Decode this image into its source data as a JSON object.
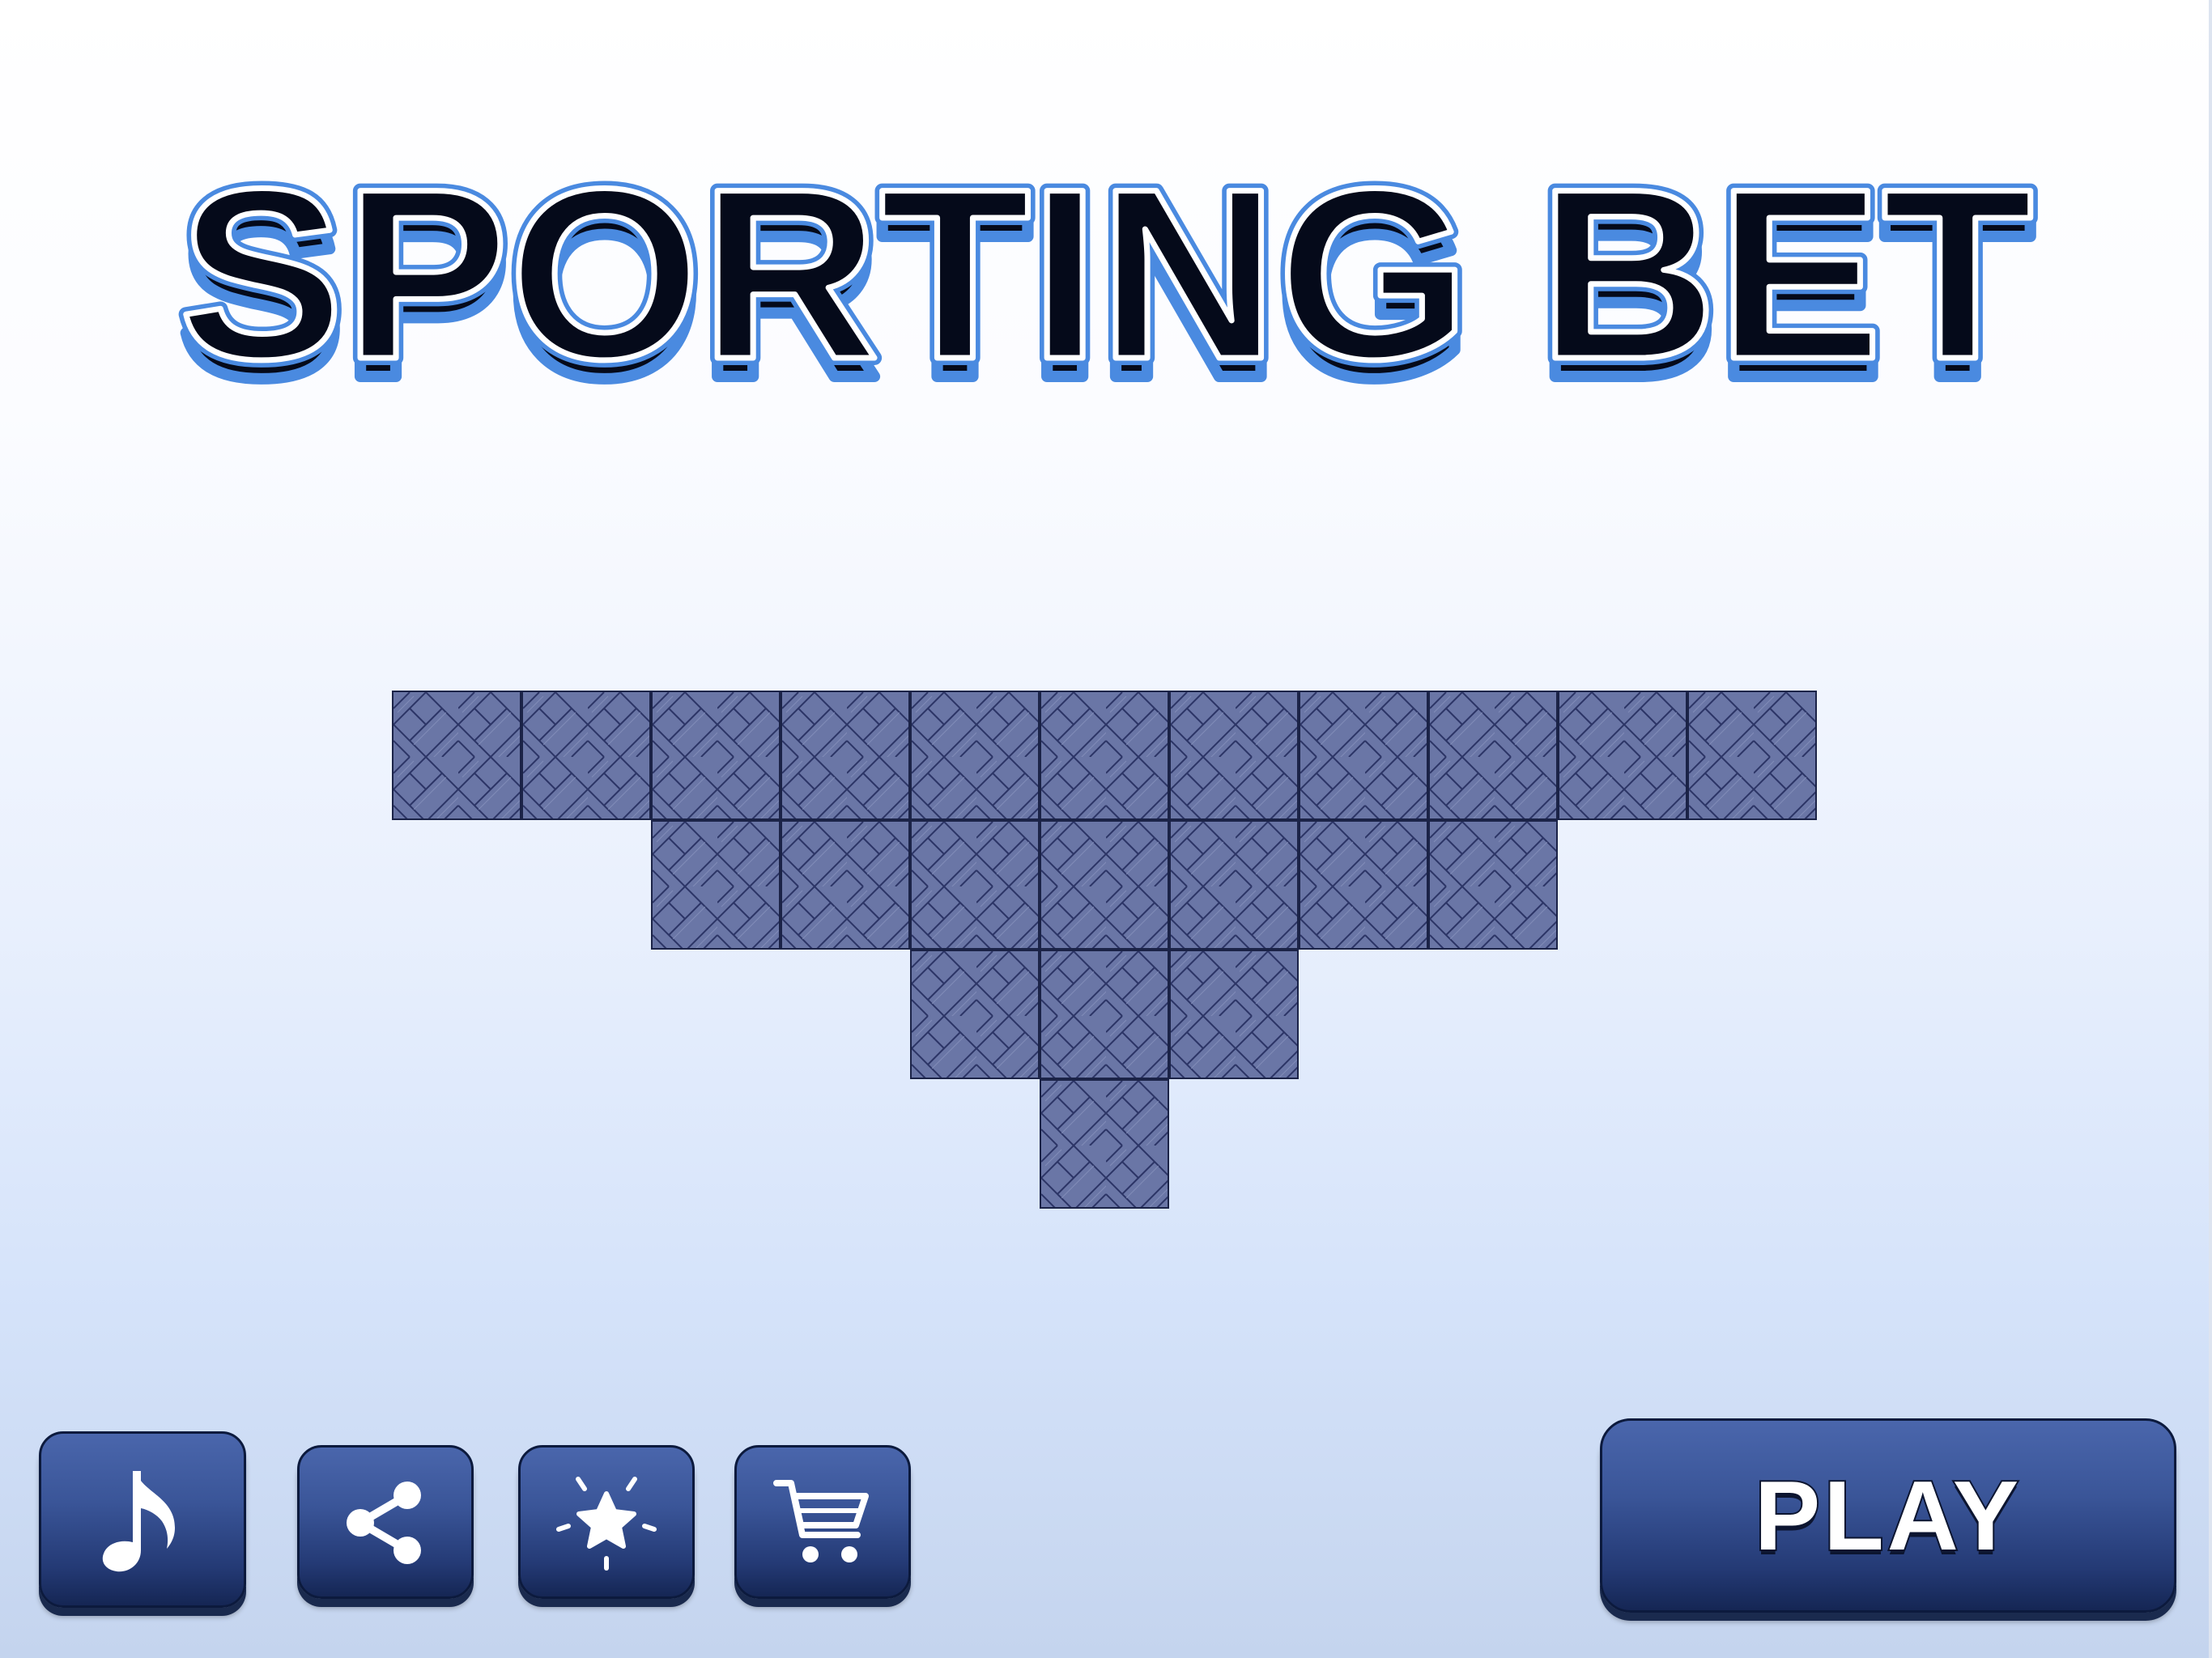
{
  "game": {
    "title": "SPORTING BET"
  },
  "board": {
    "rows": [
      11,
      7,
      3,
      1
    ],
    "tile_pattern": "woven-basket",
    "tile_color": "#6a76a6",
    "tile_border_color": "#1b2347"
  },
  "buttons": {
    "music": {
      "icon": "music-note-icon"
    },
    "share": {
      "icon": "share-icon"
    },
    "rate": {
      "icon": "star-icon"
    },
    "shop": {
      "icon": "shopping-cart-icon"
    },
    "play": {
      "label": "PLAY"
    }
  },
  "colors": {
    "title_fill": "#050a1a",
    "title_outline": "#4a8ae0",
    "button_top": "#4a66ac",
    "button_bottom": "#152654",
    "icon_color": "#ffffff"
  }
}
